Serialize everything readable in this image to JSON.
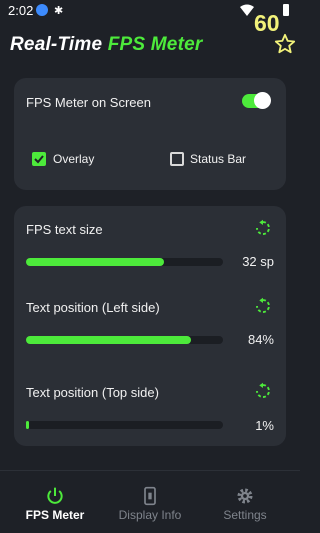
{
  "status_bar": {
    "time": "2:02",
    "fps_overlay": "60"
  },
  "header": {
    "title_prefix": "Real-Time ",
    "title_accent": "FPS Meter"
  },
  "colors": {
    "accent": "#4dea3b",
    "card": "#2b2f36",
    "background": "#1e2127",
    "fps_overlay": "#f2f27a"
  },
  "screen_card": {
    "toggle_label": "FPS Meter on Screen",
    "toggle_on": true,
    "overlay_label": "Overlay",
    "overlay_checked": true,
    "statusbar_label": "Status Bar",
    "statusbar_checked": false
  },
  "settings": [
    {
      "label": "FPS text size",
      "value": "32 sp",
      "fill": 0.7
    },
    {
      "label": "Text position (Left side)",
      "value": "84%",
      "fill": 0.84
    },
    {
      "label": "Text position (Top side)",
      "value": "1%",
      "fill": 0.01
    }
  ],
  "icons": {
    "star": "star-outline-icon",
    "reset": "reset-rotate-icon",
    "fps_meter": "power-icon",
    "display_info": "phone-info-icon",
    "settings": "gear-icon"
  },
  "nav": {
    "fps_meter": "FPS Meter",
    "display_info": "Display Info",
    "settings": "Settings",
    "active": "fps_meter"
  }
}
